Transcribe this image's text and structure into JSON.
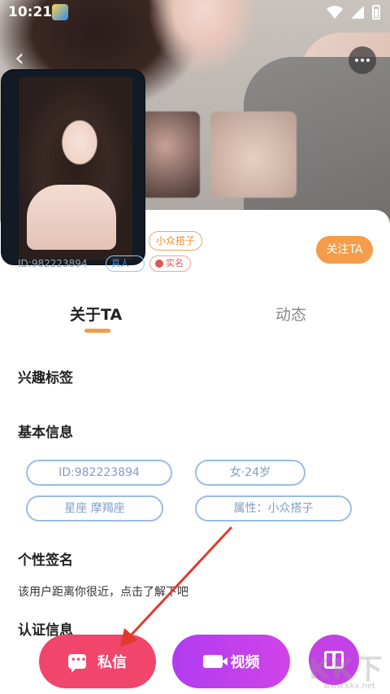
{
  "status_bar": {
    "time": "10:21"
  },
  "profile": {
    "tag": "小众搭子",
    "id_text": "ID:982223894",
    "badge_verified": "真人",
    "badge_realname": "实名",
    "follow_label": "关注TA"
  },
  "tabs": [
    {
      "label": "关于TA",
      "active": true
    },
    {
      "label": "动态",
      "active": false
    }
  ],
  "sections": {
    "interest_title": "兴趣标签",
    "basic_title": "基本信息",
    "signature_title": "个性签名",
    "cert_title": "认证信息"
  },
  "basic_info": {
    "id": "ID:982223894",
    "gender_age": "女·24岁",
    "constellation": "星座  摩羯座",
    "attribute": "属性：小众搭子"
  },
  "signature": "该用户距离你很近，点击了解下吧",
  "actions": {
    "message_label": "私信",
    "video_label": "视频"
  },
  "watermark": {
    "main": "KK下载",
    "sub": "www.kkx.net"
  },
  "colors": {
    "accent_orange": "#f59c4a",
    "message_pink": "#f2456b",
    "video_purple": "#b03cf0",
    "pill_blue": "#9dbbe4",
    "annotation_red": "#e03a2e"
  },
  "icons": [
    "back-icon",
    "more-icon",
    "wifi-icon",
    "signal-icon",
    "battery-icon",
    "chat-icon",
    "video-camera-icon",
    "gift-icon",
    "medal-icon"
  ]
}
